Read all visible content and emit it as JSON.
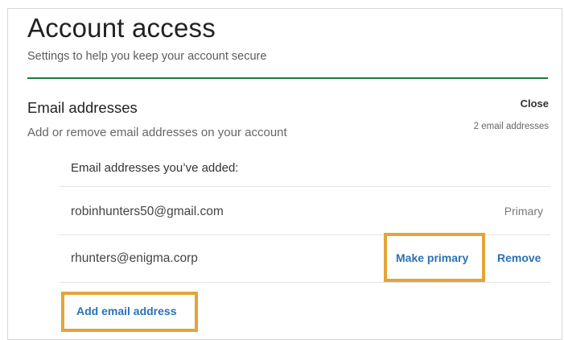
{
  "header": {
    "title": "Account access",
    "subtitle": "Settings to help you keep your account secure"
  },
  "email_section": {
    "title": "Email addresses",
    "description": "Add or remove email addresses on your account",
    "close_label": "Close",
    "count_label": "2 email addresses",
    "list_heading": "Email addresses you’ve added:",
    "emails": [
      {
        "address": "robinhunters50@gmail.com",
        "status": "Primary"
      },
      {
        "address": "rhunters@enigma.corp",
        "make_primary_label": "Make primary",
        "remove_label": "Remove"
      }
    ],
    "add_label": "Add email address"
  },
  "colors": {
    "accent_rule": "#1f7a43",
    "link": "#2a72b5",
    "highlight": "#e3a43a"
  }
}
